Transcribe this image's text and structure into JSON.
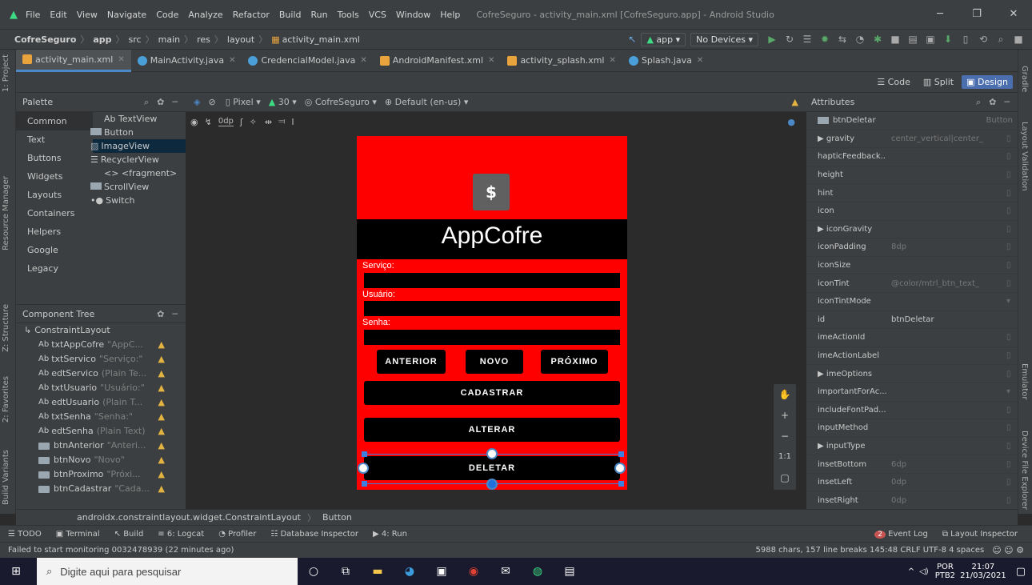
{
  "window": {
    "menu": [
      "File",
      "Edit",
      "View",
      "Navigate",
      "Code",
      "Analyze",
      "Refactor",
      "Build",
      "Run",
      "Tools",
      "VCS",
      "Window",
      "Help"
    ],
    "title": "CofreSeguro - activity_main.xml [CofreSeguro.app] - Android Studio"
  },
  "nav": {
    "crumbs": [
      "CofreSeguro",
      "app",
      "src",
      "main",
      "res",
      "layout",
      "activity_main.xml"
    ],
    "run_config": "app",
    "devices": "No Devices"
  },
  "tabs": [
    {
      "label": "activity_main.xml",
      "color": "#a9b7c6"
    },
    {
      "label": "MainActivity.java",
      "color": "#4a9fd8"
    },
    {
      "label": "CredencialModel.java",
      "color": "#4a9fd8"
    },
    {
      "label": "AndroidManifest.xml",
      "color": "#a9b7c6"
    },
    {
      "label": "activity_splash.xml",
      "color": "#a9b7c6"
    },
    {
      "label": "Splash.java",
      "color": "#4a9fd8"
    }
  ],
  "view_modes": [
    "Code",
    "Split",
    "Design"
  ],
  "left_tools": [
    "1: Project",
    "Resource Manager",
    "Z: Structure",
    "2: Favorites",
    "Build Variants"
  ],
  "right_tools": [
    "Gradle",
    "Layout Validation",
    "Emulator",
    "Device File Explorer"
  ],
  "palette": {
    "title": "Palette",
    "categories": [
      "Common",
      "Text",
      "Buttons",
      "Widgets",
      "Layouts",
      "Containers",
      "Helpers",
      "Google",
      "Legacy"
    ],
    "items": [
      "Ab TextView",
      "Button",
      "ImageView",
      "RecyclerView",
      "<> <fragment>",
      "ScrollView",
      "Switch"
    ]
  },
  "design_toolbar": {
    "device": "Pixel",
    "api": "30",
    "theme": "CofreSeguro",
    "locale": "Default (en-us)",
    "margin": "0dp"
  },
  "component_tree": {
    "title": "Component Tree",
    "root": "ConstraintLayout",
    "rows": [
      {
        "prefix": "Ab",
        "id": "txtAppCofre",
        "hint": "\"AppC..."
      },
      {
        "prefix": "Ab",
        "id": "txtServico",
        "hint": "\"Serviço:\""
      },
      {
        "prefix": "Ab",
        "id": "edtServico",
        "hint": "(Plain Te..."
      },
      {
        "prefix": "Ab",
        "id": "txtUsuario",
        "hint": "\"Usuário:\""
      },
      {
        "prefix": "Ab",
        "id": "edtUsuario",
        "hint": "(Plain T..."
      },
      {
        "prefix": "Ab",
        "id": "txtSenha",
        "hint": "\"Senha:\""
      },
      {
        "prefix": "Ab",
        "id": "edtSenha",
        "hint": "(Plain Text)"
      },
      {
        "prefix": "btn",
        "id": "btnAnterior",
        "hint": "\"Anteri..."
      },
      {
        "prefix": "btn",
        "id": "btnNovo",
        "hint": "\"Novo\""
      },
      {
        "prefix": "btn",
        "id": "btnProximo",
        "hint": "\"Próxi..."
      },
      {
        "prefix": "btn",
        "id": "btnCadastrar",
        "hint": "\"Cada..."
      }
    ]
  },
  "phone": {
    "app_title": "AppCofre",
    "label_servico": "Serviço:",
    "label_usuario": "Usuário:",
    "label_senha": "Senha:",
    "btn_anterior": "ANTERIOR",
    "btn_novo": "NOVO",
    "btn_proximo": "PRÓXIMO",
    "btn_cadastrar": "CADASTRAR",
    "btn_alterar": "ALTERAR",
    "btn_deletar": "DELETAR"
  },
  "zoom": [
    "+",
    "−",
    "1:1"
  ],
  "attributes": {
    "title": "Attributes",
    "component": "btnDeletar",
    "component_type": "Button",
    "rows": [
      {
        "name": "▶ gravity",
        "value": "center_vertical|center_"
      },
      {
        "name": "hapticFeedback...",
        "value": ""
      },
      {
        "name": "height",
        "value": ""
      },
      {
        "name": "hint",
        "value": ""
      },
      {
        "name": "icon",
        "value": ""
      },
      {
        "name": "▶ iconGravity",
        "value": ""
      },
      {
        "name": "iconPadding",
        "value": "8dp"
      },
      {
        "name": "iconSize",
        "value": ""
      },
      {
        "name": "iconTint",
        "value": "@color/mtrl_btn_text_"
      },
      {
        "name": "iconTintMode",
        "value": ""
      },
      {
        "name": "id",
        "value": "btnDeletar"
      },
      {
        "name": "imeActionId",
        "value": ""
      },
      {
        "name": "imeActionLabel",
        "value": ""
      },
      {
        "name": "▶ imeOptions",
        "value": ""
      },
      {
        "name": "importantForAc...",
        "value": ""
      },
      {
        "name": "includeFontPad...",
        "value": ""
      },
      {
        "name": "inputMethod",
        "value": ""
      },
      {
        "name": "▶ inputType",
        "value": ""
      },
      {
        "name": "insetBottom",
        "value": "6dp"
      },
      {
        "name": "insetLeft",
        "value": "0dp"
      },
      {
        "name": "insetRight",
        "value": "0dp"
      }
    ]
  },
  "breadcrumb": [
    "androidx.constraintlayout.widget.ConstraintLayout",
    "Button"
  ],
  "tool_windows": [
    "TODO",
    "Terminal",
    "Build",
    "6: Logcat",
    "Profiler",
    "Database Inspector",
    "4: Run"
  ],
  "event_log": "Event Log",
  "layout_inspector": "Layout Inspector",
  "status": {
    "message": "Failed to start monitoring 0032478939 (22 minutes ago)",
    "right": "5988 chars, 157 line breaks  145:48  CRLF  UTF-8  4 spaces"
  },
  "taskbar": {
    "search_placeholder": "Digite aqui para pesquisar",
    "lang": "POR",
    "kbd": "PTB2",
    "time": "21:07",
    "date": "21/03/2021"
  }
}
